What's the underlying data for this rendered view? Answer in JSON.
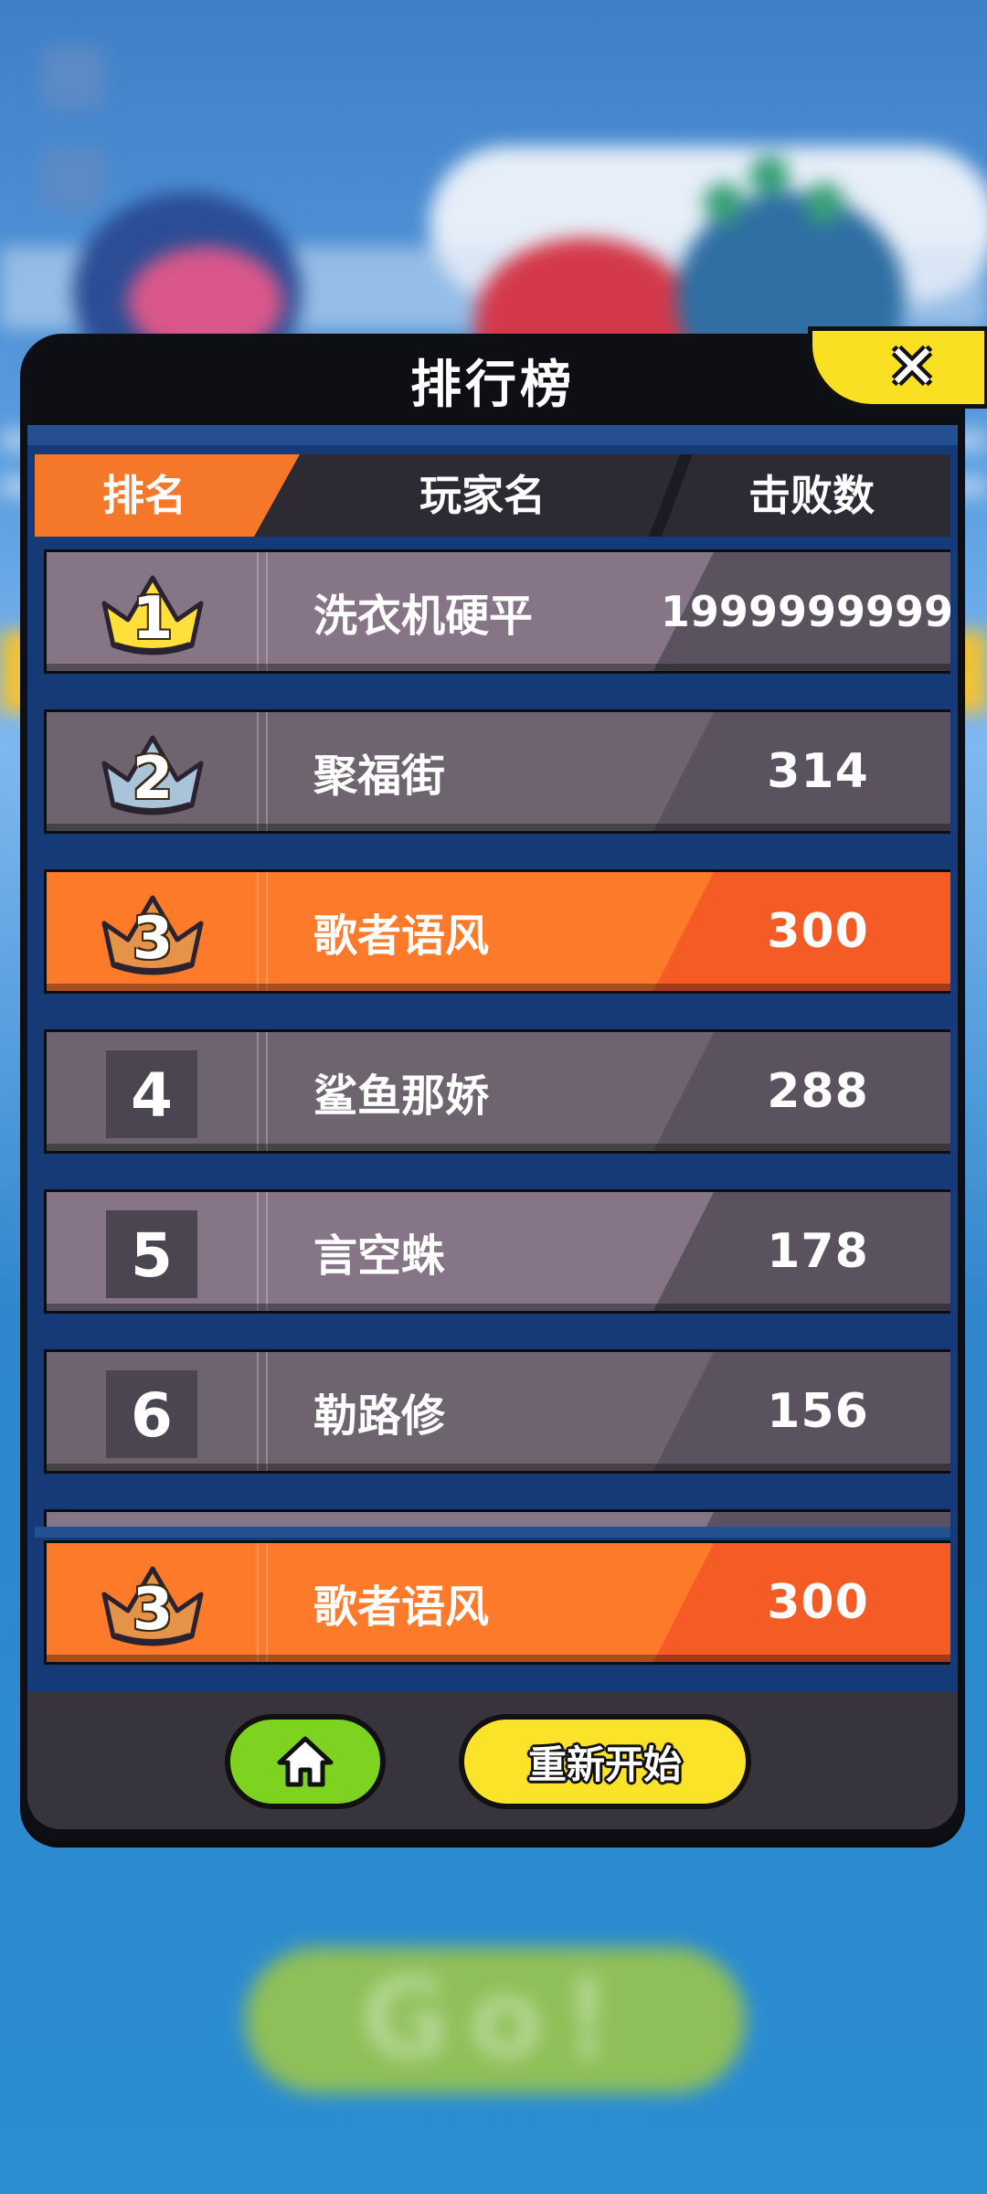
{
  "panel": {
    "title": "排行榜",
    "close_icon": "close-x-icon"
  },
  "header": {
    "rank": "排名",
    "player": "玩家名",
    "score": "击败数"
  },
  "colors": {
    "row_light": "#857586",
    "row_dark": "#6e646f",
    "score_dark": "#5b5260",
    "row_highlight": "#fd7a2b",
    "score_highlight": "#f45b25",
    "gold": "#ffe03a",
    "silver": "#a9c4d8",
    "bronze": "#e6934a",
    "home_button": "#7ed321",
    "restart_button": "#fbe329"
  },
  "rows": [
    {
      "rank": "1",
      "medal": "gold-crown-icon",
      "name": "洗衣机硬平",
      "score": "1999999999",
      "highlight": false
    },
    {
      "rank": "2",
      "medal": "silver-crown-icon",
      "name": "聚福街",
      "score": "314",
      "highlight": false
    },
    {
      "rank": "3",
      "medal": "bronze-crown-icon",
      "name": "歌者语风",
      "score": "300",
      "highlight": true
    },
    {
      "rank": "4",
      "medal": "",
      "name": "鲨鱼那娇",
      "score": "288",
      "highlight": false
    },
    {
      "rank": "5",
      "medal": "",
      "name": "言空蛛",
      "score": "178",
      "highlight": false
    },
    {
      "rank": "6",
      "medal": "",
      "name": "勒路修",
      "score": "156",
      "highlight": false
    }
  ],
  "self_row": {
    "rank": "3",
    "medal": "bronze-crown-icon",
    "name": "歌者语风",
    "score": "300"
  },
  "footer": {
    "home_icon": "home-icon",
    "restart_label": "重新开始"
  },
  "background": {
    "go_button_label": "Go!"
  }
}
